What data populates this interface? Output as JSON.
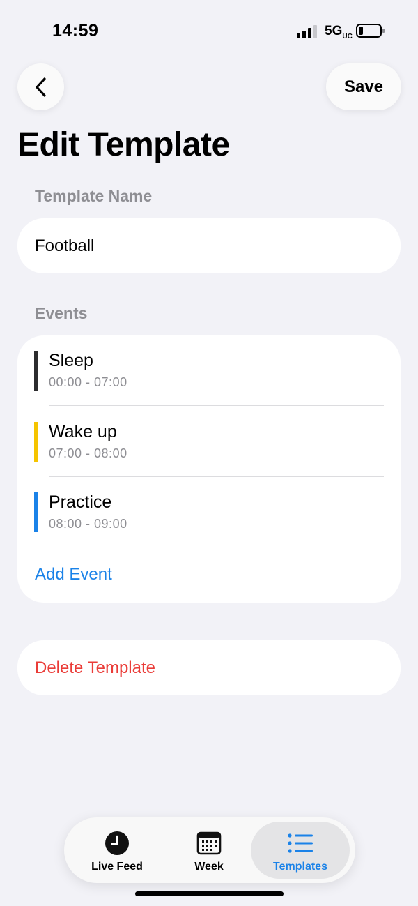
{
  "status_bar": {
    "time": "14:59",
    "network": "5G",
    "network_suffix": "UC"
  },
  "header": {
    "save_label": "Save",
    "title": "Edit Template"
  },
  "template_name": {
    "label": "Template Name",
    "value": "Football"
  },
  "events": {
    "label": "Events",
    "items": [
      {
        "title": "Sleep",
        "time": "00:00 - 07:00",
        "color": "#2c2c2e"
      },
      {
        "title": "Wake up",
        "time": "07:00 - 08:00",
        "color": "#f5c400"
      },
      {
        "title": "Practice",
        "time": "08:00 - 09:00",
        "color": "#1a82e8"
      }
    ],
    "add_label": "Add Event"
  },
  "delete_label": "Delete Template",
  "tabs": [
    {
      "label": "Live Feed",
      "icon": "clock-icon"
    },
    {
      "label": "Week",
      "icon": "calendar-icon"
    },
    {
      "label": "Templates",
      "icon": "list-icon",
      "selected": true
    }
  ],
  "colors": {
    "accent": "#1a82e8",
    "destructive": "#ea3c38",
    "background": "#f2f2f7"
  }
}
